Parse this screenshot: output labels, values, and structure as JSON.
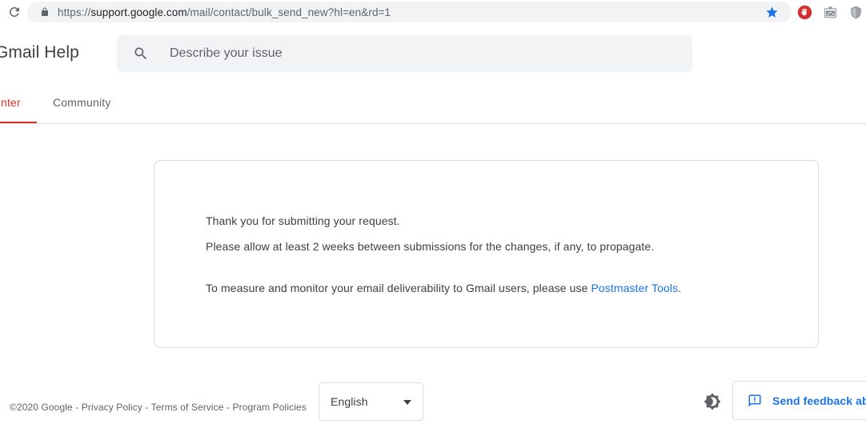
{
  "browser": {
    "reload_icon": "reload-icon",
    "lock_icon": "lock-icon",
    "url_scheme": "https://",
    "url_host": "support.google.com",
    "url_path": "/mail/contact/bulk_send_new?hl=en&rd=1",
    "url_full": "https://support.google.com/mail/contact/bulk_send_new?hl=en&rd=1",
    "star_icon": "bookmark-star-icon",
    "star_color": "#1a73e8",
    "extensions": [
      {
        "icon": "adblock-stop-hand-icon",
        "color": "#d32f2f"
      },
      {
        "icon": "mail-clipboard-icon",
        "color": "#9aa0a6"
      },
      {
        "icon": "shield-privacy-icon",
        "color": "#80868b"
      }
    ]
  },
  "header": {
    "product_title": "Gmail Help",
    "search": {
      "icon": "search-icon",
      "placeholder": "Describe your issue",
      "value": ""
    }
  },
  "tabs": [
    {
      "label": "enter",
      "active": true,
      "accent": "#d93025"
    },
    {
      "label": "Community",
      "active": false
    }
  ],
  "main": {
    "paragraph_1": "Thank you for submitting your request.",
    "paragraph_2": "Please allow at least 2 weeks between submissions for the changes, if any, to propagate.",
    "paragraph_3_prefix": "To measure and monitor your email deliverability to Gmail users, please use ",
    "paragraph_3_link": "Postmaster Tools",
    "paragraph_3_suffix": ".",
    "link_color": "#1a73e8"
  },
  "footer": {
    "copyright": "©2020 Google",
    "sep_1": " - ",
    "privacy": "Privacy Policy",
    "sep_2": " - ",
    "terms": "Terms of Service",
    "sep_3": " - ",
    "policies": "Program Policies",
    "language": {
      "selected": "English",
      "arrow_icon": "chevron-down-icon"
    },
    "dark_mode": {
      "icon": "brightness-dark-mode-icon"
    },
    "feedback": {
      "icon": "feedback-chat-icon",
      "label": "Send feedback abo",
      "color": "#1a73e8"
    }
  }
}
